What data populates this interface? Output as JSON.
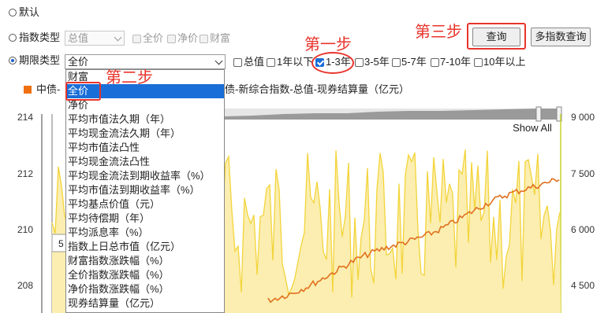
{
  "filters": {
    "default_label": "默认",
    "index_type": {
      "label": "指数类型",
      "selected": "总值",
      "checkboxes": [
        "全价",
        "净价",
        "财富"
      ]
    },
    "term_type": {
      "label": "期限类型",
      "selected": "全价",
      "checkboxes": [
        {
          "label": "总值",
          "checked": false
        },
        {
          "label": "1年以下",
          "checked": false
        },
        {
          "label": "1-3年",
          "checked": true
        },
        {
          "label": "3-5年",
          "checked": false
        },
        {
          "label": "5-7年",
          "checked": false
        },
        {
          "label": "7-10年",
          "checked": false
        },
        {
          "label": "10年以上",
          "checked": false
        }
      ]
    }
  },
  "buttons": {
    "query": "查询",
    "multi_query": "多指数查询"
  },
  "annotations": {
    "step1": "第一步",
    "step2": "第二步",
    "step3": "第三步"
  },
  "dropdown": {
    "options": [
      "财富",
      "全价",
      "净价",
      "平均市值法久期（年）",
      "平均现金流法久期（年）",
      "平均市值法凸性",
      "平均现金流法凸性",
      "平均现金流法到期收益率（%）",
      "平均市值法到期收益率（%）",
      "平均基点价值（元）",
      "平均待偿期（年）",
      "平均派息率（%）",
      "指数上日总市值（亿元）",
      "财富指数涨跌幅（%）",
      "全价指数涨跌幅（%）",
      "净价指数涨跌幅（%）",
      "现券结算量（亿元）"
    ],
    "highlighted_index": 1
  },
  "chart": {
    "legend": {
      "series1_prefix": "中债-",
      "series2_suffix": "债-新综合指数-总值-现券结算量（亿元）"
    },
    "show_all": "Show All",
    "left_ticks": [
      "214",
      "212",
      "210",
      "208"
    ],
    "right_ticks": [
      "9 000",
      "7 500",
      "6 000",
      "4 500"
    ],
    "partial_label": "5",
    "colors": {
      "line": "#e0701e",
      "area": "#f3d43a",
      "legend_square": "#f07010",
      "annotation": "#e8342b",
      "highlight": "#1a6ed8"
    }
  }
}
